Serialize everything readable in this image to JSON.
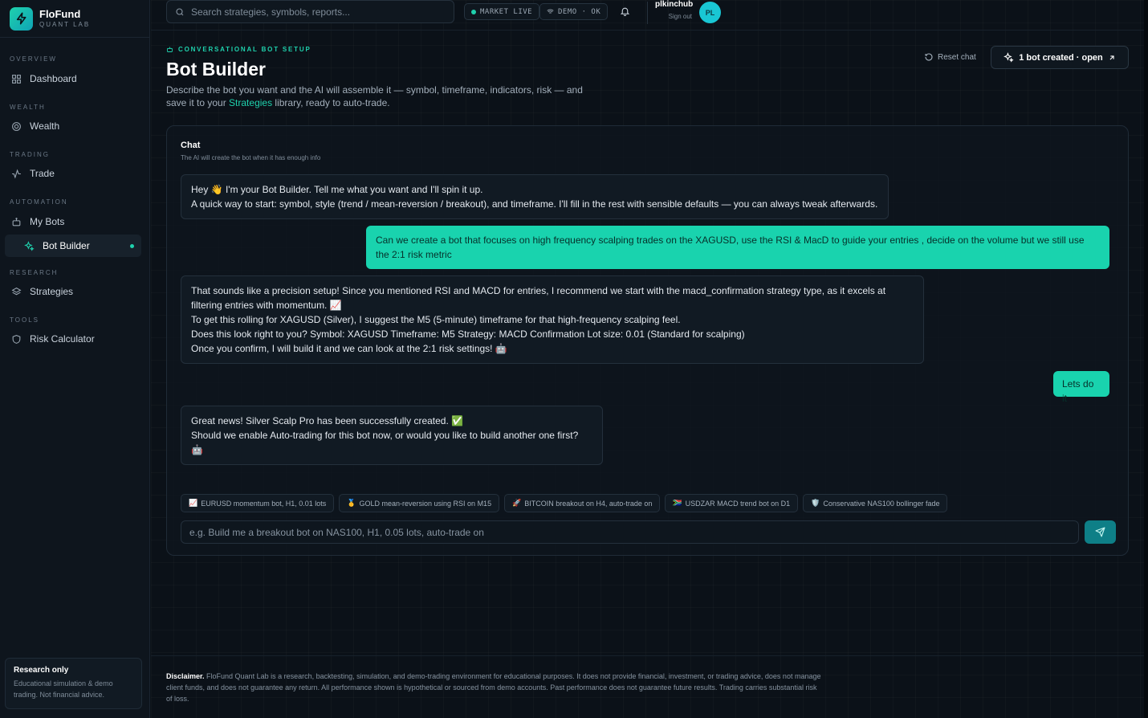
{
  "brand": {
    "name": "FloFund",
    "sub": "QUANT LAB"
  },
  "nav": {
    "overview": "OVERVIEW",
    "dashboard": "Dashboard",
    "wealth_section": "WEALTH",
    "wealth": "Wealth",
    "trading_section": "TRADING",
    "trade": "Trade",
    "automation_section": "AUTOMATION",
    "my_bots": "My Bots",
    "bot_builder": "Bot Builder",
    "research_section": "RESEARCH",
    "strategies": "Strategies",
    "tools_section": "TOOLS",
    "risk_calculator": "Risk Calculator"
  },
  "research_card": {
    "title": "Research only",
    "text": "Educational simulation & demo trading. Not financial advice."
  },
  "topbar": {
    "search_placeholder": "Search strategies, symbols, reports...",
    "market_status": "MARKET LIVE",
    "demo_status": "DEMO · OK",
    "username": "plkinchub",
    "sign_out": "Sign out",
    "avatar_initials": "PL"
  },
  "header": {
    "eyebrow": "CONVERSATIONAL BOT SETUP",
    "title": "Bot Builder",
    "desc_before": "Describe the bot you want and the AI will assemble it — symbol, timeframe, indicators, risk — and save it to your ",
    "desc_link": "Strategies",
    "desc_after": " library, ready to auto-trade.",
    "reset_label": "Reset chat",
    "open_label": "1 bot created · open"
  },
  "chat": {
    "title": "Chat",
    "subtitle": "The AI will create the bot when it has enough info",
    "messages": [
      {
        "role": "bot",
        "lines": [
          "Hey 👋 I'm your Bot Builder. Tell me what you want and I'll spin it up.",
          "A quick way to start: symbol, style (trend / mean-reversion / breakout), and timeframe. I'll fill in the rest with sensible defaults — you can always tweak afterwards."
        ]
      },
      {
        "role": "user",
        "lines": [
          "Can we create a bot that focuses on high frequency scalping trades on the XAGUSD, use the RSI & MacD to guide your entries , decide on the volume but we still use the 2:1 risk metric"
        ]
      },
      {
        "role": "bot",
        "lines": [
          "That sounds like a precision setup! Since you mentioned RSI and MACD for entries, I recommend we start with the macd_confirmation strategy type, as it excels at filtering entries with momentum. 📈",
          "To get this rolling for XAGUSD (Silver), I suggest the M5 (5-minute) timeframe for that high-frequency scalping feel.",
          "Does this look right to you? Symbol: XAGUSD Timeframe: M5 Strategy: MACD Confirmation Lot size: 0.01 (Standard for scalping)",
          "Once you confirm, I will build it and we can look at the 2:1 risk settings! 🤖"
        ]
      },
      {
        "role": "user",
        "lines": [
          "Lets do it"
        ]
      },
      {
        "role": "bot",
        "lines": [
          "Great news! Silver Scalp Pro has been successfully created. ✅",
          "Should we enable Auto-trading for this bot now, or would you like to build another one first? 🤖"
        ]
      }
    ],
    "suggestions": [
      {
        "emoji": "📈",
        "text": "EURUSD momentum bot, H1, 0.01 lots"
      },
      {
        "emoji": "🥇",
        "text": "GOLD mean-reversion using RSI on M15"
      },
      {
        "emoji": "🚀",
        "text": "BITCOIN breakout on H4, auto-trade on"
      },
      {
        "emoji": "🇿🇦",
        "text": "USDZAR MACD trend bot on D1"
      },
      {
        "emoji": "🛡️",
        "text": "Conservative NAS100 bollinger fade"
      }
    ],
    "input_placeholder": "e.g. Build me a breakout bot on NAS100, H1, 0.05 lots, auto-trade on"
  },
  "footer": {
    "label": "Disclaimer.",
    "text": " FloFund Quant Lab is a research, backtesting, simulation, and demo-trading environment for educational purposes. It does not provide financial, investment, or trading advice, does not manage client funds, and does not guarantee any return. All performance shown is hypothetical or sourced from demo accounts. Past performance does not guarantee future results. Trading carries substantial risk of loss."
  },
  "colors": {
    "accent": "#1fd1ad",
    "background": "#0b1118",
    "user_bubble": "#19d3ae"
  }
}
